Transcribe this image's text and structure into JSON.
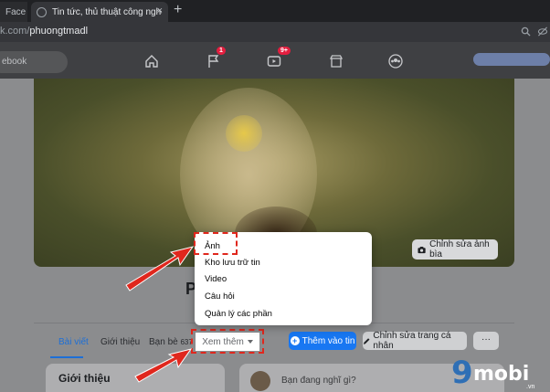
{
  "browser": {
    "tab1_title": "Face",
    "tab2_title": "Tin tức, thủ thuật công nghệ mới",
    "tab_close": "×",
    "new_tab": "+",
    "url_prefix": "k.com/",
    "url_path": "phuongtmadl"
  },
  "fb_nav": {
    "search_placeholder": "ebook",
    "flag_badge": "1",
    "video_badge": "9+"
  },
  "cover": {
    "edit_label": "Chỉnh sửa ảnh bìa"
  },
  "profile": {
    "name_initial": "P"
  },
  "profile_tabs": {
    "posts": "Bài viết",
    "about": "Giới thiệu",
    "friends": "Bạn bè",
    "friends_count": "637",
    "more": "Xem thêm"
  },
  "actions": {
    "add_story": "Thêm vào tin",
    "edit_profile": "Chỉnh sửa trang cá nhân",
    "more": "···"
  },
  "more_menu": {
    "items": [
      "Ảnh",
      "Kho lưu trữ tin",
      "Video",
      "Câu hỏi",
      "Quản lý các phần"
    ]
  },
  "intro": {
    "title": "Giới thiệu"
  },
  "composer": {
    "placeholder": "Bạn đang nghĩ gì?"
  },
  "watermark": {
    "nine": "9",
    "mobi": "mobi",
    "tld": ".vn"
  },
  "colors": {
    "highlight": "#e0271d",
    "primary": "#1877f2",
    "badge": "#e41e3f"
  }
}
